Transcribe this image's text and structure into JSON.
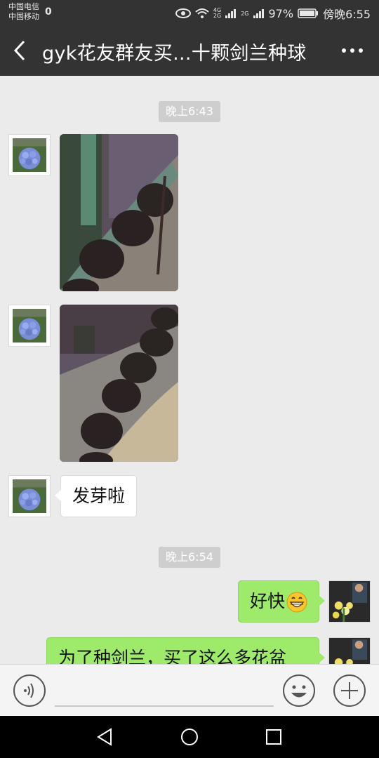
{
  "status_bar": {
    "carrier_1": "中国电信",
    "carrier_2": "中国移动",
    "carrier_hd": "0",
    "net_1": "4G",
    "net_2": "2G",
    "net_3": "2G",
    "battery": "97%",
    "time": "傍晚6:55"
  },
  "header": {
    "title": "gyk花友群友买...十颗剑兰种球",
    "back_icon": "chevron-left-icon",
    "more_icon": "more-dots-icon"
  },
  "messages": {
    "time_1": "晚上6:43",
    "text_1": "发芽啦",
    "time_2": "晚上6:54",
    "out_1": "好快",
    "out_1_emoji": "grinning-face-icon",
    "out_2": "为了种剑兰，买了这么多花盆"
  },
  "input_bar": {
    "voice_icon": "voice-icon",
    "emoji_icon": "emoji-icon",
    "plus_icon": "plus-icon"
  },
  "colors": {
    "header_bg": "#333333",
    "chat_bg": "#ebebeb",
    "outgoing_bubble": "#9eea6a",
    "incoming_bubble": "#ffffff",
    "time_chip": "#cecece"
  }
}
